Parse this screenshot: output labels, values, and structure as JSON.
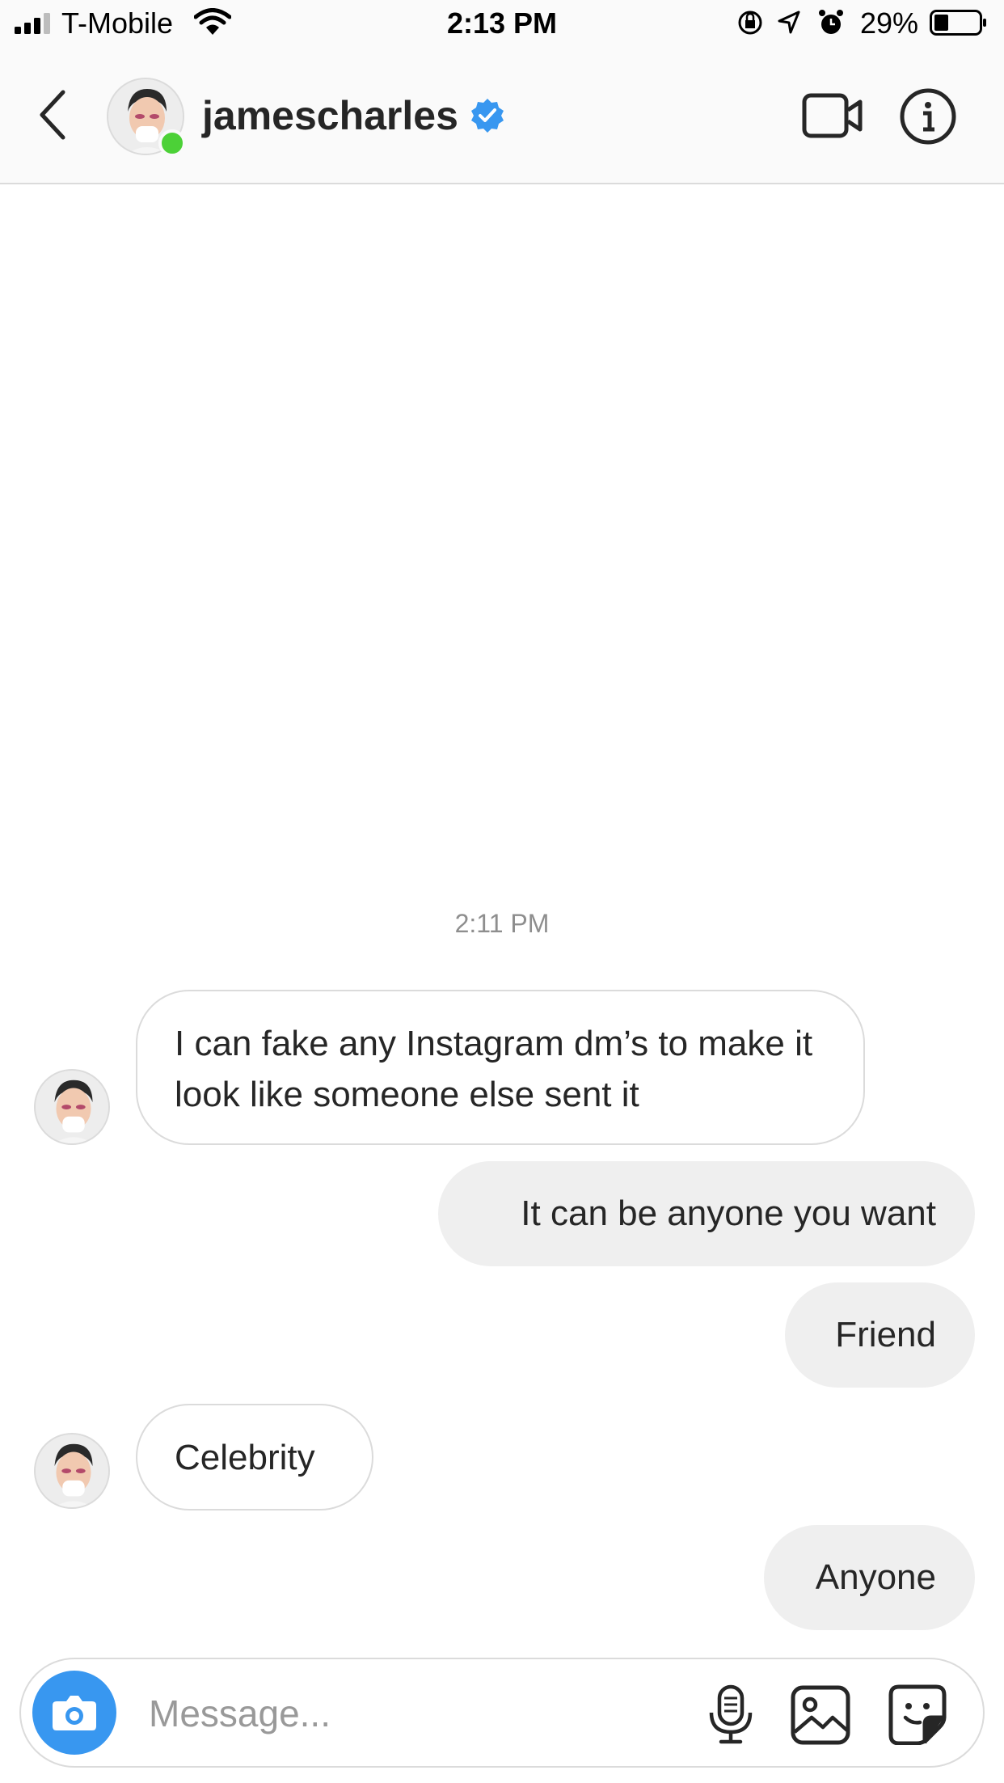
{
  "status_bar": {
    "carrier": "T-Mobile",
    "time": "2:13 PM",
    "battery_percent": "29%"
  },
  "header": {
    "username": "jamescharles"
  },
  "chat": {
    "timestamp": "2:11 PM",
    "messages": [
      {
        "sender": "jamescharles",
        "direction": "incoming",
        "text": "I can fake any Instagram dm’s to make it look like someone else sent it"
      },
      {
        "sender": "me",
        "direction": "outgoing",
        "text": "It can be anyone you want"
      },
      {
        "sender": "me",
        "direction": "outgoing",
        "text": "Friend"
      },
      {
        "sender": "jamescharles",
        "direction": "incoming",
        "text": "Celebrity"
      },
      {
        "sender": "me",
        "direction": "outgoing",
        "text": "Anyone"
      }
    ]
  },
  "composer": {
    "placeholder": "Message..."
  },
  "colors": {
    "accent": "#3897f0",
    "online": "#4cd137",
    "outgoing_bubble": "#efefef",
    "border": "#dbdbdb"
  }
}
